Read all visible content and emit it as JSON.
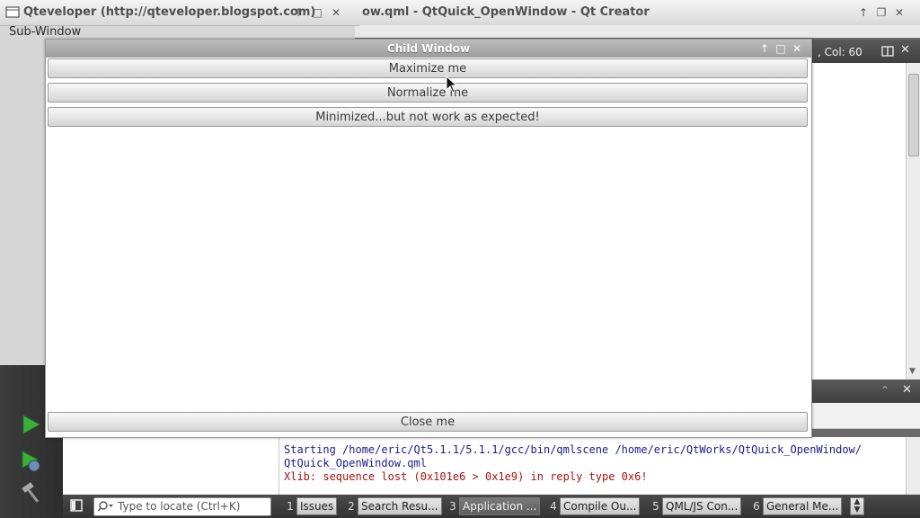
{
  "sub_window": {
    "title": "Qteveloper (http://qteveloper.blogspot.com)",
    "label": "Sub-Window"
  },
  "qt_creator": {
    "title": "ow.qml - QtQuick_OpenWindow - Qt Creator",
    "editor_status": ", Col: 60",
    "locate_placeholder": "Type to locate (Ctrl+K)",
    "output_lines": [
      "Starting /home/eric/Qt5.1.1/5.1.1/gcc/bin/qmlscene /home/eric/QtWorks/QtQuick_OpenWindow/",
      "QtQuick_OpenWindow.qml",
      "Xlib: sequence lost (0x101e6 > 0x1e9) in reply type 0x6!"
    ],
    "output_tabs": [
      {
        "num": "1",
        "label": "Issues"
      },
      {
        "num": "2",
        "label": "Search Resu..."
      },
      {
        "num": "3",
        "label": "Application ..."
      },
      {
        "num": "4",
        "label": "Compile Ou..."
      },
      {
        "num": "5",
        "label": "QML/JS Con..."
      },
      {
        "num": "6",
        "label": "General Me..."
      }
    ]
  },
  "child_window": {
    "title": "Child Window",
    "buttons": {
      "maximize": "Maximize me",
      "normalize": "Normalize me",
      "minimize": "Minimized...but not work as expected!",
      "close": "Close me"
    }
  },
  "icons": {
    "window_icon": "window-icon",
    "run": "run-icon",
    "debug_run": "debug-run-icon",
    "build": "hammer-icon",
    "search": "search-icon",
    "sidebar_toggle": "sidebar-toggle-icon",
    "split": "split-icon",
    "close": "close-icon",
    "maximize": "maximize-icon",
    "minimize": "minimize-icon",
    "restore": "restore-icon"
  },
  "colors": {
    "output_normal": "#1a1a8c",
    "output_error": "#aa1111",
    "run_green": "#3ab03a"
  }
}
